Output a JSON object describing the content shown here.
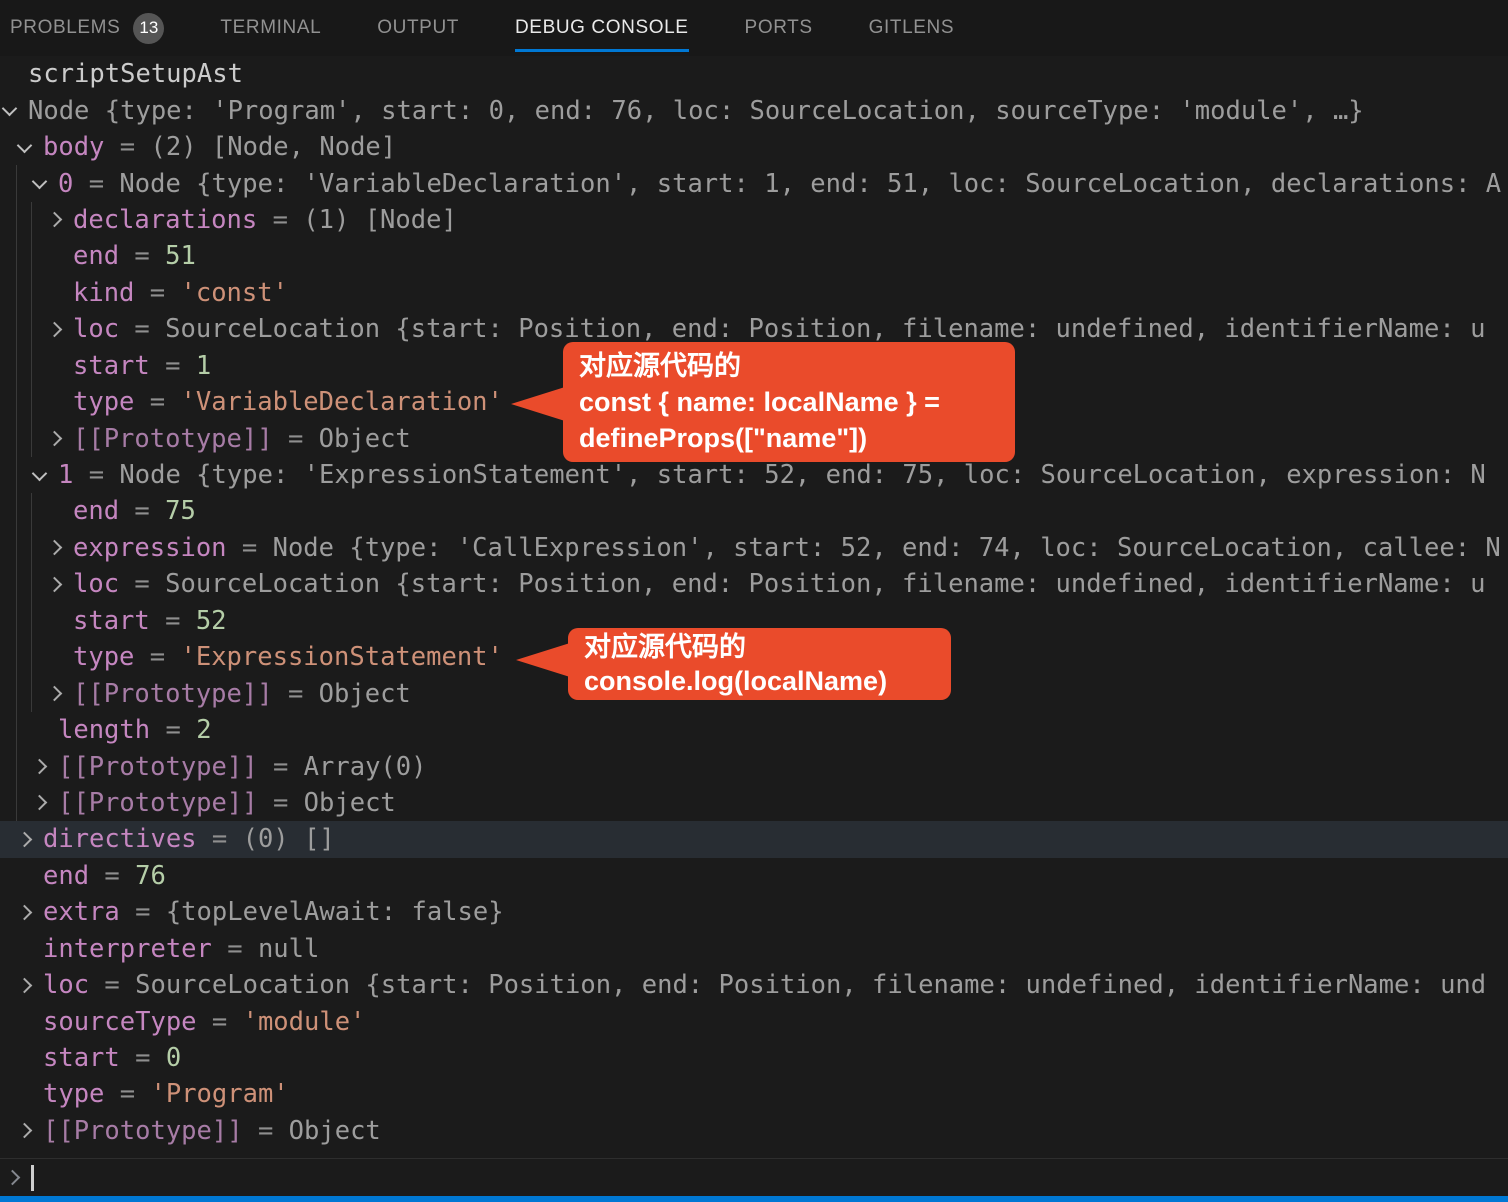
{
  "tabbar": {
    "accent_color": "#0078d4",
    "tabs": [
      {
        "label": "PROBLEMS",
        "badge": "13",
        "active": false
      },
      {
        "label": "TERMINAL",
        "active": false
      },
      {
        "label": "OUTPUT",
        "active": false
      },
      {
        "label": "DEBUG CONSOLE",
        "active": true
      },
      {
        "label": "PORTS",
        "active": false
      },
      {
        "label": "GITLENS",
        "active": false
      }
    ]
  },
  "console": {
    "header": "scriptSetupAst",
    "colors": {
      "property_name": "#C586C0",
      "prototype_name": "#A77CA6",
      "number": "#B5CEA8",
      "string": "#CE9178",
      "object_summary": "#9d9d9d",
      "highlight_row_bg": "#282d33"
    },
    "rows": [
      {
        "level": 0,
        "chevron": "down",
        "segments": [
          {
            "t": "gray",
            "v": "Node {type: 'Program', start: 0, end: 76, loc: SourceLocation, sourceType: 'module', …}"
          }
        ]
      },
      {
        "level": 1,
        "chevron": "down",
        "segments": [
          {
            "t": "name",
            "v": "body"
          },
          {
            "t": "op",
            "v": " = "
          },
          {
            "t": "gray",
            "v": "(2) [Node, Node]"
          }
        ]
      },
      {
        "level": 2,
        "chevron": "down",
        "segments": [
          {
            "t": "name",
            "v": "0"
          },
          {
            "t": "op",
            "v": " = "
          },
          {
            "t": "gray",
            "v": "Node {type: 'VariableDeclaration', start: 1, end: 51, loc: SourceLocation, declarations: A"
          }
        ]
      },
      {
        "level": 3,
        "chevron": "right",
        "segments": [
          {
            "t": "name",
            "v": "declarations"
          },
          {
            "t": "op",
            "v": " = "
          },
          {
            "t": "gray",
            "v": "(1) [Node]"
          }
        ]
      },
      {
        "level": 3,
        "chevron": "none",
        "segments": [
          {
            "t": "name",
            "v": "end"
          },
          {
            "t": "op",
            "v": " = "
          },
          {
            "t": "num",
            "v": "51"
          }
        ]
      },
      {
        "level": 3,
        "chevron": "none",
        "segments": [
          {
            "t": "name",
            "v": "kind"
          },
          {
            "t": "op",
            "v": " = "
          },
          {
            "t": "str",
            "v": "'const'"
          }
        ]
      },
      {
        "level": 3,
        "chevron": "right",
        "segments": [
          {
            "t": "name",
            "v": "loc"
          },
          {
            "t": "op",
            "v": " = "
          },
          {
            "t": "gray",
            "v": "SourceLocation {start: Position, end: Position, filename: undefined, identifierName: u"
          }
        ]
      },
      {
        "level": 3,
        "chevron": "none",
        "segments": [
          {
            "t": "name",
            "v": "start"
          },
          {
            "t": "op",
            "v": " = "
          },
          {
            "t": "num",
            "v": "1"
          }
        ]
      },
      {
        "level": 3,
        "chevron": "none",
        "segments": [
          {
            "t": "name",
            "v": "type"
          },
          {
            "t": "op",
            "v": " = "
          },
          {
            "t": "str",
            "v": "'VariableDeclaration'"
          }
        ]
      },
      {
        "level": 3,
        "chevron": "right",
        "segments": [
          {
            "t": "proto",
            "v": "[[Prototype]]"
          },
          {
            "t": "op",
            "v": " = "
          },
          {
            "t": "gray",
            "v": "Object"
          }
        ]
      },
      {
        "level": 2,
        "chevron": "down",
        "segments": [
          {
            "t": "name",
            "v": "1"
          },
          {
            "t": "op",
            "v": " = "
          },
          {
            "t": "gray",
            "v": "Node {type: 'ExpressionStatement', start: 52, end: 75, loc: SourceLocation, expression: N"
          }
        ]
      },
      {
        "level": 3,
        "chevron": "none",
        "segments": [
          {
            "t": "name",
            "v": "end"
          },
          {
            "t": "op",
            "v": " = "
          },
          {
            "t": "num",
            "v": "75"
          }
        ]
      },
      {
        "level": 3,
        "chevron": "right",
        "segments": [
          {
            "t": "name",
            "v": "expression"
          },
          {
            "t": "op",
            "v": " = "
          },
          {
            "t": "gray",
            "v": "Node {type: 'CallExpression', start: 52, end: 74, loc: SourceLocation, callee: N"
          }
        ]
      },
      {
        "level": 3,
        "chevron": "right",
        "segments": [
          {
            "t": "name",
            "v": "loc"
          },
          {
            "t": "op",
            "v": " = "
          },
          {
            "t": "gray",
            "v": "SourceLocation {start: Position, end: Position, filename: undefined, identifierName: u"
          }
        ]
      },
      {
        "level": 3,
        "chevron": "none",
        "segments": [
          {
            "t": "name",
            "v": "start"
          },
          {
            "t": "op",
            "v": " = "
          },
          {
            "t": "num",
            "v": "52"
          }
        ]
      },
      {
        "level": 3,
        "chevron": "none",
        "segments": [
          {
            "t": "name",
            "v": "type"
          },
          {
            "t": "op",
            "v": " = "
          },
          {
            "t": "str",
            "v": "'ExpressionStatement'"
          }
        ]
      },
      {
        "level": 3,
        "chevron": "right",
        "segments": [
          {
            "t": "proto",
            "v": "[[Prototype]]"
          },
          {
            "t": "op",
            "v": " = "
          },
          {
            "t": "gray",
            "v": "Object"
          }
        ]
      },
      {
        "level": 2,
        "chevron": "none",
        "segments": [
          {
            "t": "name",
            "v": "length"
          },
          {
            "t": "op",
            "v": " = "
          },
          {
            "t": "num",
            "v": "2"
          }
        ]
      },
      {
        "level": 2,
        "chevron": "right",
        "segments": [
          {
            "t": "proto",
            "v": "[[Prototype]]"
          },
          {
            "t": "op",
            "v": " = "
          },
          {
            "t": "gray",
            "v": "Array(0)"
          }
        ]
      },
      {
        "level": 2,
        "chevron": "right",
        "segments": [
          {
            "t": "proto",
            "v": "[[Prototype]]"
          },
          {
            "t": "op",
            "v": " = "
          },
          {
            "t": "gray",
            "v": "Object"
          }
        ]
      },
      {
        "level": 1,
        "chevron": "right",
        "highlighted": true,
        "segments": [
          {
            "t": "name",
            "v": "directives"
          },
          {
            "t": "op",
            "v": " = "
          },
          {
            "t": "gray",
            "v": "(0) []"
          }
        ]
      },
      {
        "level": 1,
        "chevron": "none",
        "segments": [
          {
            "t": "name",
            "v": "end"
          },
          {
            "t": "op",
            "v": " = "
          },
          {
            "t": "num",
            "v": "76"
          }
        ]
      },
      {
        "level": 1,
        "chevron": "right",
        "segments": [
          {
            "t": "name",
            "v": "extra"
          },
          {
            "t": "op",
            "v": " = "
          },
          {
            "t": "gray",
            "v": "{topLevelAwait: false}"
          }
        ]
      },
      {
        "level": 1,
        "chevron": "none",
        "segments": [
          {
            "t": "name",
            "v": "interpreter"
          },
          {
            "t": "op",
            "v": " = "
          },
          {
            "t": "gray",
            "v": "null"
          }
        ]
      },
      {
        "level": 1,
        "chevron": "right",
        "segments": [
          {
            "t": "name",
            "v": "loc"
          },
          {
            "t": "op",
            "v": " = "
          },
          {
            "t": "gray",
            "v": "SourceLocation {start: Position, end: Position, filename: undefined, identifierName: und"
          }
        ]
      },
      {
        "level": 1,
        "chevron": "none",
        "segments": [
          {
            "t": "name",
            "v": "sourceType"
          },
          {
            "t": "op",
            "v": " = "
          },
          {
            "t": "str",
            "v": "'module'"
          }
        ]
      },
      {
        "level": 1,
        "chevron": "none",
        "segments": [
          {
            "t": "name",
            "v": "start"
          },
          {
            "t": "op",
            "v": " = "
          },
          {
            "t": "num",
            "v": "0"
          }
        ]
      },
      {
        "level": 1,
        "chevron": "none",
        "segments": [
          {
            "t": "name",
            "v": "type"
          },
          {
            "t": "op",
            "v": " = "
          },
          {
            "t": "str",
            "v": "'Program'"
          }
        ]
      },
      {
        "level": 1,
        "chevron": "right",
        "segments": [
          {
            "t": "proto",
            "v": "[[Prototype]]"
          },
          {
            "t": "op",
            "v": " = "
          },
          {
            "t": "gray",
            "v": "Object"
          }
        ]
      }
    ]
  },
  "callouts": [
    {
      "color": "#EA4B2B",
      "lines": [
        "对应源代码的",
        "const { name: localName } =",
        "defineProps([\"name\"])"
      ]
    },
    {
      "color": "#EA4B2B",
      "lines": [
        "对应源代码的",
        "console.log(localName)"
      ]
    }
  ]
}
